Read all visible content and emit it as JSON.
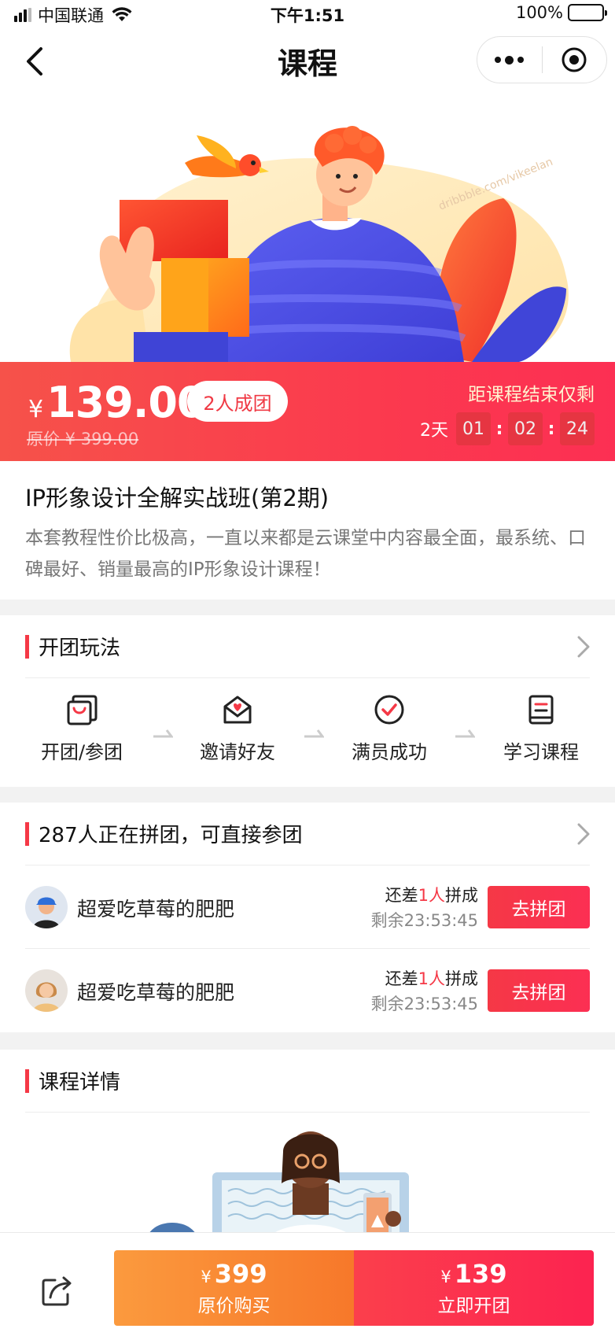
{
  "status_bar": {
    "carrier": "中国联通",
    "time": "下午1:51",
    "battery": "100%"
  },
  "nav": {
    "title": "课程"
  },
  "banner": {
    "watermark": "dribbble.com/vikeelan"
  },
  "price": {
    "currency": "¥",
    "current": "139.00",
    "group_badge": "2人成团",
    "original": "原价 ¥ 399.00"
  },
  "countdown": {
    "label": "距课程结束仅剩",
    "days": "2天",
    "hours": "01",
    "minutes": "02",
    "seconds": "24"
  },
  "course": {
    "title": "IP形象设计全解实战班(第2期)",
    "description": "本套教程性价比极高，一直以来都是云课堂中内容最全面，最系统、口碑最好、销量最高的IP形象设计课程！"
  },
  "rules": {
    "heading": "开团玩法",
    "steps": [
      {
        "label": "开团/参团",
        "icon": "bag-icon"
      },
      {
        "label": "邀请好友",
        "icon": "invite-envelope-icon"
      },
      {
        "label": "满员成功",
        "icon": "check-circle-icon"
      },
      {
        "label": "学习课程",
        "icon": "book-icon"
      }
    ]
  },
  "groups": {
    "heading": "287人正在拼团，可直接参团",
    "items": [
      {
        "name": "超爱吃草莓的肥肥",
        "need_prefix": "还差",
        "need_count": "1人",
        "need_suffix": "拼成",
        "remain": "剩余23:53:45",
        "button": "去拼团"
      },
      {
        "name": "超爱吃草莓的肥肥",
        "need_prefix": "还差",
        "need_count": "1人",
        "need_suffix": "拼成",
        "remain": "剩余23:53:45",
        "button": "去拼团"
      }
    ]
  },
  "details": {
    "heading": "课程详情"
  },
  "bottom_bar": {
    "original_price_currency": "¥",
    "original_price": "399",
    "original_label": "原价购买",
    "group_price_currency": "¥",
    "group_price": "139",
    "group_label": "立即开团"
  },
  "colors": {
    "accent_red": "#f53846",
    "accent_orange": "#f7782a"
  }
}
